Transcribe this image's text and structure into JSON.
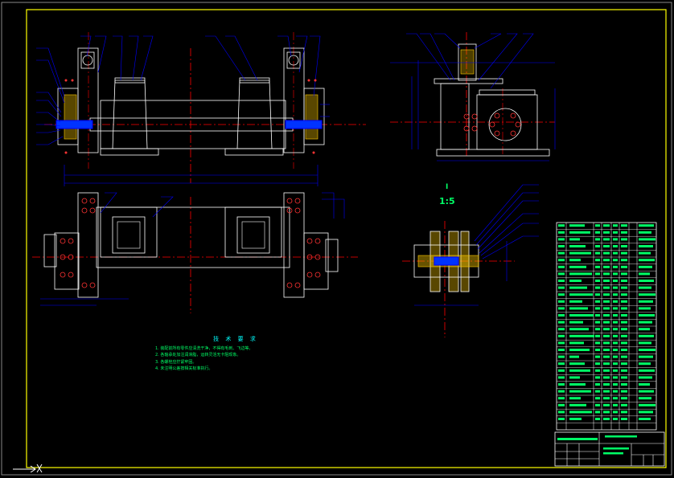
{
  "drawing": {
    "background": "#000000",
    "frame_color": "#ffff00",
    "line_color": "#0000ff",
    "outline_color": "#ffffff",
    "center_color": "#ff0000",
    "text_color": "#00ff66"
  },
  "detail": {
    "label": "I",
    "scale": "1:5"
  },
  "tech_notes": {
    "title": "技 术 要 求",
    "items": [
      "1. 装配前所有零件应清洗干净，不得有毛刺、飞边等。",
      "2. 各轴承处加注润滑脂，运转灵活无卡阻现象。",
      "3. 各螺栓应拧紧牢固。",
      "4. 未注明公差按相关标准执行。"
    ]
  }
}
